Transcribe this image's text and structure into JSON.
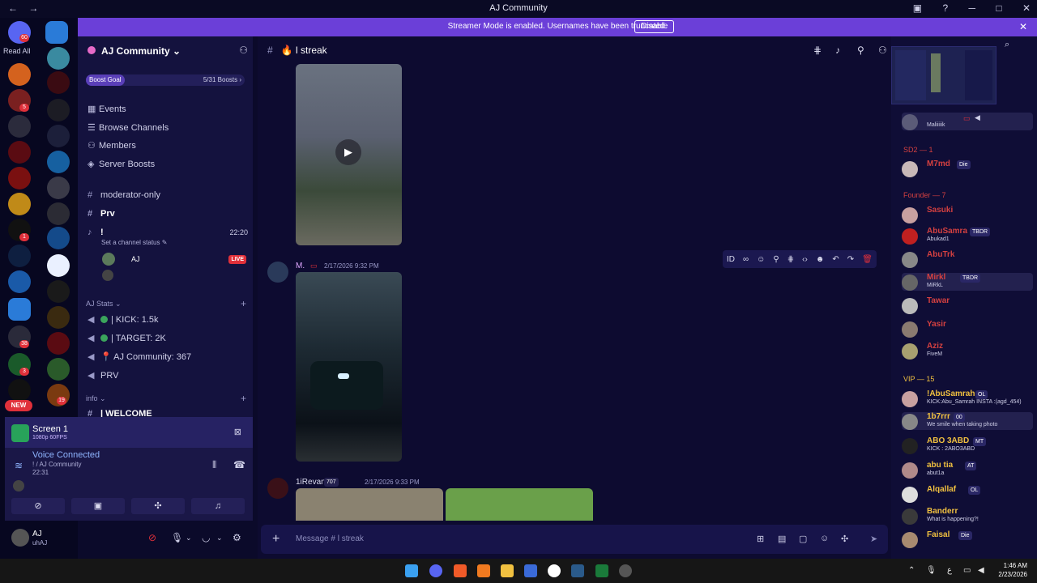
{
  "window": {
    "title": "AJ Community",
    "nav_back": "←",
    "nav_forward": "→",
    "minimize": "─",
    "maximize": "□",
    "close": "✕"
  },
  "guildbar": {
    "read_all_label": "Read All",
    "new_badge": "NEW",
    "badges": [
      "60",
      "5",
      "1",
      "38",
      "3",
      "19"
    ]
  },
  "banner": {
    "message": "Streamer Mode is enabled. Usernames have been truncated.",
    "disable_label": "Disable",
    "close": "✕"
  },
  "server": {
    "name": "AJ Community",
    "boost_goal_label": "Boost Goal",
    "boost_progress": "5/31 Boosts ›",
    "nav": [
      "Events",
      "Browse Channels",
      "Members",
      "Server Boosts"
    ],
    "channels_top": [
      "moderator-only",
      "Prv"
    ],
    "voice_channel": {
      "name": "!",
      "duration": "22:20",
      "status_placeholder": "Set a channel status",
      "user": "AJ",
      "live_label": "LIVE"
    },
    "category_stats": "AJ Stats",
    "stats_channels": [
      "| KICK: 1.5k",
      "| TARGET: 2K",
      "AJ Community: 367",
      "PRV"
    ],
    "category_info": "info",
    "info_channels": [
      "| WELCOME"
    ]
  },
  "voice_panel": {
    "screen_title": "Screen 1",
    "screen_quality": "1080p 60FPS",
    "connected_label": "Voice Connected",
    "channel_path": "! / AJ Community",
    "elapsed": "22:31"
  },
  "user": {
    "name": "AJ",
    "status": "uhAJ"
  },
  "chat": {
    "channel_name": "l streak",
    "messages": [
      {
        "author": "M.",
        "time": "2/17/2026 9:32 PM"
      },
      {
        "author": "1iRevan",
        "role_tag": "707",
        "time": "2/17/2026 9:33 PM"
      }
    ],
    "composer_placeholder": "Message # l streak"
  },
  "members": {
    "top_member_status": "Maliiiiik",
    "groups": [
      {
        "title": "SD2 — 1",
        "members": [
          {
            "name": "M7md",
            "tag": "Die"
          }
        ]
      },
      {
        "title": "Founder — 7",
        "members": [
          {
            "name": "Sasuki",
            "status": ""
          },
          {
            "name": "AbuSamra",
            "tag": "TBDR",
            "status": "Abukad1"
          },
          {
            "name": "AbuTrk",
            "status": ""
          },
          {
            "name": "Mirkl",
            "tag": "TBDR",
            "status": "MiRkL"
          },
          {
            "name": "Tawar",
            "status": ""
          },
          {
            "name": "Yasir",
            "status": ""
          },
          {
            "name": "Aziz",
            "status": "FiveM"
          }
        ]
      },
      {
        "title": "VIP — 15",
        "members": [
          {
            "name": "!AbuSamrah",
            "tag": "OL",
            "status": "KICK:Abu_Samrah INSTA :(agd_454)"
          },
          {
            "name": "1b7rrr",
            "tag": "00",
            "status": "We smile when taking photo"
          },
          {
            "name": "ABO 3ABD",
            "tag": "MT",
            "status": "KICK : 2ABO3ABD"
          },
          {
            "name": "abu tia",
            "tag": "AT",
            "status": "abut1a"
          },
          {
            "name": "Alqallaf",
            "tag": "OL",
            "status": ""
          },
          {
            "name": "Banderr",
            "status": "What is happening?!"
          },
          {
            "name": "Faisal",
            "tag": "Die",
            "status": ""
          }
        ]
      }
    ]
  },
  "taskbar": {
    "time": "1:46 AM",
    "date": "2/23/2026"
  },
  "colors": {
    "banner": "#6b3fd8",
    "background": "#0b0a2a",
    "live": "#e0303a",
    "vip_name": "#f0c040",
    "founder_name": "#d44040"
  }
}
